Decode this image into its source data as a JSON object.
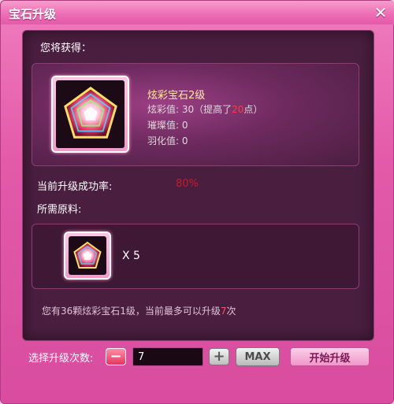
{
  "window": {
    "title": "宝石升级",
    "close_icon": "close-icon"
  },
  "reward": {
    "heading": "您将获得：",
    "gem_name": "炫彩宝石2级",
    "stat1_prefix": "炫彩值: 30（提高了",
    "stat1_value": "20",
    "stat1_suffix": "点）",
    "stat2": "璀璨值: 0",
    "stat3": "羽化值: 0"
  },
  "success": {
    "label": "当前升级成功率:",
    "rate": "80%"
  },
  "materials": {
    "heading": "所需原料:",
    "quantity": "X 5"
  },
  "hint": {
    "prefix": "您有36颗炫彩宝石1级，当前最多可以升级",
    "count": "7",
    "suffix": "次"
  },
  "controls": {
    "label": "选择升级次数:",
    "minus": "−",
    "count_value": "7",
    "plus": "+",
    "max_label": "MAX",
    "start_label": "开始升级"
  },
  "colors": {
    "window_bg": "#e35aa9",
    "panel_bg": "#4a1e3f",
    "highlight_red": "#ff3a3a",
    "rate_red": "#c61c28",
    "gem_name_color": "#ffeaa0"
  }
}
